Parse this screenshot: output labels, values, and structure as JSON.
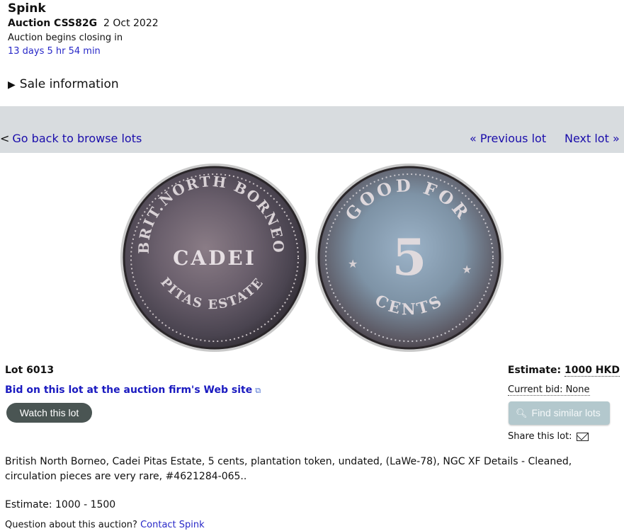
{
  "header": {
    "firm": "Spink",
    "auction_code": "Auction CSS82G",
    "auction_date": "2 Oct 2022",
    "closing_label": "Auction begins closing in",
    "countdown": "13 days 5 hr 54 min",
    "sale_info": "Sale information"
  },
  "nav": {
    "back_prefix": "<",
    "back": "Go back to browse lots",
    "prev": "« Previous lot",
    "next": "Next lot »"
  },
  "coin": {
    "obverse_inner": "CADEI",
    "obverse_ring": "BRIT.NORTH BORNEO · PITAS ESTATE",
    "reverse_top": "GOOD FOR",
    "reverse_center": "5",
    "reverse_bottom": "CENTS"
  },
  "lot": {
    "number": "Lot 6013",
    "bid_link": "Bid on this lot at the auction firm's Web site",
    "watch": "Watch this lot",
    "estimate_label": "Estimate:",
    "estimate_value": "1000 HKD",
    "current_bid": "Current bid: None",
    "find_similar": "Find similar lots",
    "share": "Share this lot:",
    "description": "British North Borneo, Cadei Pitas Estate, 5 cents, plantation token, undated, (LaWe-78), NGC XF Details - Cleaned, circulation pieces are very rare, #4621284-065..",
    "estimate_range": "Estimate: 1000 - 1500",
    "question": "Question about this auction?",
    "contact": "Contact Spink"
  },
  "icons": [
    "external-link-icon",
    "magnifier-icon",
    "mail-icon",
    "disclosure-triangle-icon"
  ]
}
